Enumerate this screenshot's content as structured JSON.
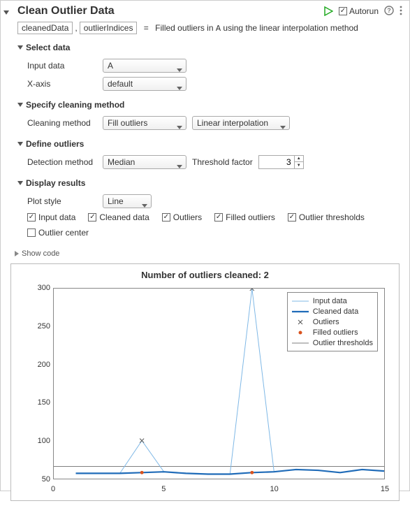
{
  "header": {
    "title": "Clean Outlier Data",
    "autorun_label": "Autorun",
    "autorun_checked": true
  },
  "outputs": {
    "var1": "cleanedData",
    "var2": "outlierIndices",
    "eq": "=",
    "desc_a": "Filled outliers in ",
    "desc_var": "A",
    "desc_b": " using the linear interpolation method"
  },
  "sections": {
    "select_data": {
      "title": "Select data",
      "input_data_label": "Input data",
      "input_data_value": "A",
      "xaxis_label": "X-axis",
      "xaxis_value": "default"
    },
    "cleaning": {
      "title": "Specify cleaning method",
      "method_label": "Cleaning method",
      "method_value": "Fill outliers",
      "interp_value": "Linear interpolation"
    },
    "define": {
      "title": "Define outliers",
      "detection_label": "Detection method",
      "detection_value": "Median",
      "threshold_label": "Threshold factor",
      "threshold_value": "3"
    },
    "display": {
      "title": "Display results",
      "plot_style_label": "Plot style",
      "plot_style_value": "Line",
      "chk_input": "Input data",
      "chk_clean": "Cleaned data",
      "chk_outliers": "Outliers",
      "chk_filled": "Filled outliers",
      "chk_thresh": "Outlier thresholds",
      "chk_center": "Outlier center"
    }
  },
  "show_code_label": "Show code",
  "chart_data": {
    "type": "line",
    "title": "Number of outliers cleaned: 2",
    "xlim": [
      0,
      15
    ],
    "ylim": [
      50,
      300
    ],
    "xticks": [
      0,
      5,
      10,
      15
    ],
    "yticks": [
      50,
      100,
      150,
      200,
      250,
      300
    ],
    "x": [
      1,
      2,
      3,
      4,
      5,
      6,
      7,
      8,
      9,
      10,
      11,
      12,
      13,
      14,
      15
    ],
    "series": [
      {
        "name": "Input data",
        "type": "line-thin",
        "values": [
          57,
          57,
          57,
          100,
          59,
          57,
          56,
          56,
          300,
          59,
          62,
          61,
          58,
          62,
          60
        ]
      },
      {
        "name": "Cleaned data",
        "type": "line-thick",
        "values": [
          57,
          57,
          57,
          58,
          59,
          57,
          56,
          56,
          58,
          59,
          62,
          61,
          58,
          62,
          60
        ]
      },
      {
        "name": "Outliers",
        "type": "marker-x",
        "points": [
          {
            "x": 4,
            "y": 100
          },
          {
            "x": 9,
            "y": 300
          }
        ]
      },
      {
        "name": "Filled outliers",
        "type": "marker-dot",
        "points": [
          {
            "x": 4,
            "y": 58
          },
          {
            "x": 9,
            "y": 58
          }
        ]
      },
      {
        "name": "Outlier thresholds",
        "type": "hline",
        "y": 66
      }
    ],
    "legend": [
      "Input data",
      "Cleaned data",
      "Outliers",
      "Filled outliers",
      "Outlier thresholds"
    ]
  }
}
